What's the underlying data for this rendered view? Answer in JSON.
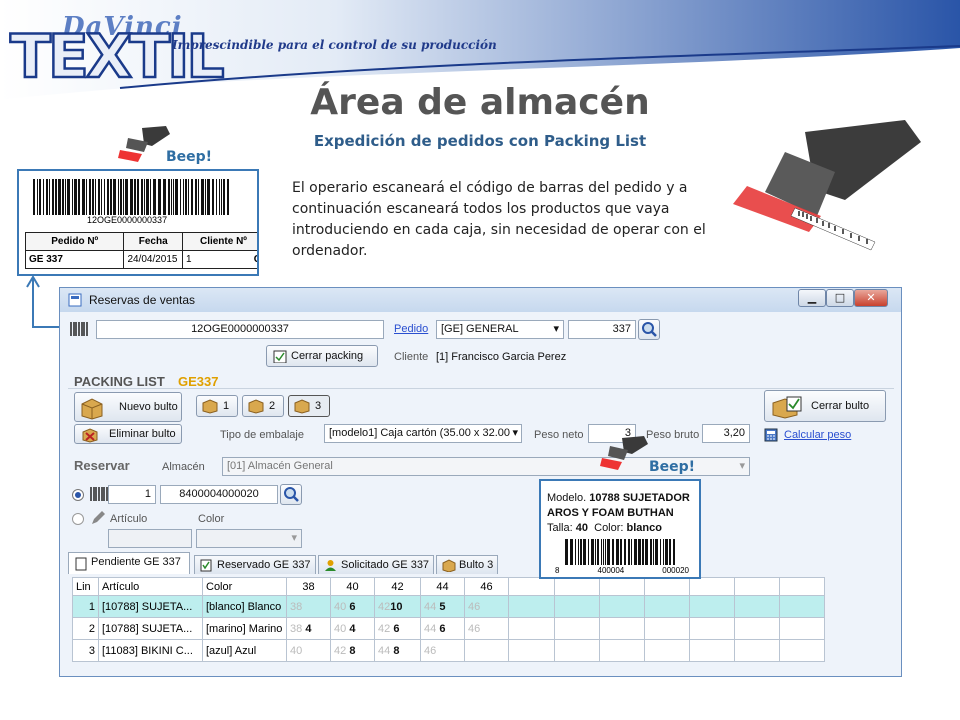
{
  "header": {
    "logo_top": "DaVinci",
    "logo_main": "TEXTIL",
    "tagline": "Imprescindible para el control de su producción"
  },
  "title": "Área de almacén",
  "subtitle": "Expedición de pedidos con Packing List",
  "description": "El operario escaneará el código de barras del pedido y a continuación escaneará todos los productos que vaya introduciendo en cada caja, sin necesidad de operar con el ordenador.",
  "beep_label": "Beep!",
  "label_card": {
    "barcode": "12OGE0000000337",
    "headers": [
      "Pedido Nº",
      "Fecha",
      "Cliente Nº"
    ],
    "values": [
      "GE 337",
      "24/04/2015",
      "1",
      "C"
    ]
  },
  "window": {
    "title": "Reservas de ventas",
    "controls": [
      "▁",
      "□",
      "✕"
    ],
    "barcode_input": "12OGE0000000337",
    "pedido_link": "Pedido",
    "pedido_select": "[GE] GENERAL",
    "pedido_number": "337",
    "cerrar_packing": "Cerrar packing",
    "cliente_label": "Cliente",
    "cliente_value": "[1] Francisco Garcia  Perez",
    "packing_list_label": "PACKING LIST",
    "packing_list_code": "GE337",
    "nuevo_bulto": "Nuevo bulto",
    "bultos": [
      "1",
      "2",
      "3"
    ],
    "cerrar_bulto": "Cerrar bulto",
    "eliminar_bulto": "Eliminar bulto",
    "tipo_embalaje_label": "Tipo de embalaje",
    "tipo_embalaje_value": "[modelo1] Caja cartón (35.00 x 32.00",
    "peso_neto_label": "Peso neto",
    "peso_neto_value": "3",
    "peso_bruto_label": "Peso bruto",
    "peso_bruto_value": "3,20",
    "calcular_peso": "Calcular peso",
    "reservar_label": "Reservar",
    "almacen_label": "Almacén",
    "almacen_value": "[01] Almacén General",
    "qty_value": "1",
    "scan_value": "8400004000020",
    "articulo_label": "Artículo",
    "color_label": "Color",
    "tabs": [
      "Pendiente GE 337",
      "Reservado GE 337",
      "Solicitado GE 337",
      "Bulto 3"
    ],
    "grid_headers": [
      "Lin",
      "Artículo",
      "Color",
      "38",
      "40",
      "42",
      "44",
      "46"
    ],
    "grid_rows": [
      {
        "lin": "1",
        "articulo": "[10788] SUJETA...",
        "color": "[blanco] Blanco",
        "s38": "38",
        "q38": "",
        "s40": "40",
        "q40": "6",
        "s42": "42",
        "q42": "10",
        "s44": "44",
        "q44": "5",
        "s46": "46"
      },
      {
        "lin": "2",
        "articulo": "[10788] SUJETA...",
        "color": "[marino] Marino",
        "s38": "38",
        "q38": "4",
        "s40": "40",
        "q40": "4",
        "s42": "42",
        "q42": "6",
        "s44": "44",
        "q44": "6",
        "s46": "46"
      },
      {
        "lin": "3",
        "articulo": "[11083] BIKINI C...",
        "color": "[azul] Azul",
        "s38": "40",
        "q38": "",
        "s40": "42",
        "q40": "8",
        "s42": "44",
        "q42": "8",
        "s44": "46",
        "q44": "",
        "s46": ""
      }
    ]
  },
  "product_card": {
    "modelo_label": "Modelo.",
    "modelo_value": "10788 SUJETADOR AROS Y FOAM BUTHAN",
    "talla_label": "Talla:",
    "talla_value": "40",
    "color_label": "Color:",
    "color_value": "blanco",
    "barcode_digits": [
      "8",
      "400004",
      "000020"
    ]
  },
  "colors": {
    "accent": "#2f5d8a",
    "frame": "#3b79b6",
    "row_highlight": "#bdeeee",
    "brand_blue": "#1a3a8a"
  }
}
